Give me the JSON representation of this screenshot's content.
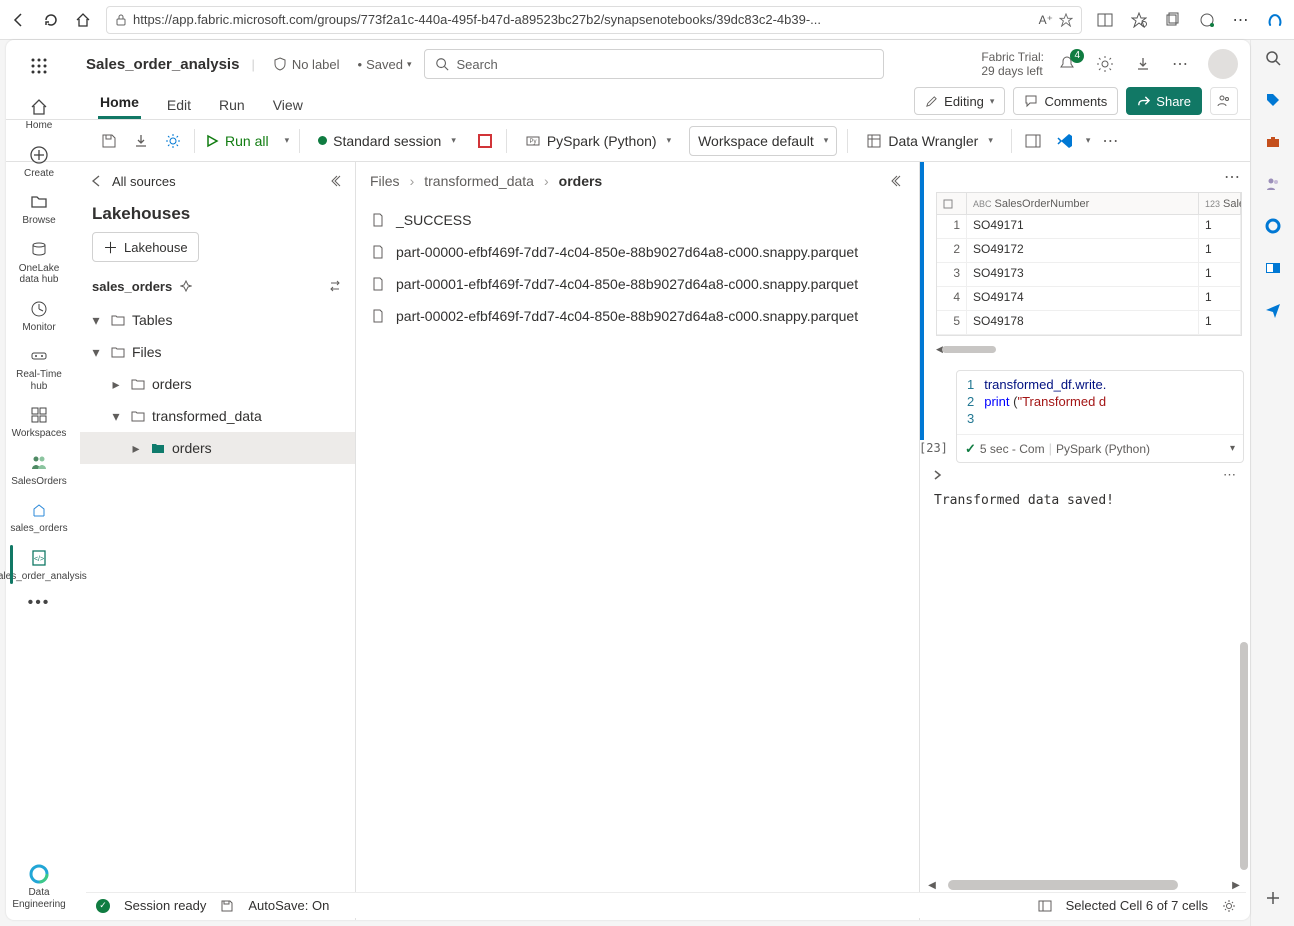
{
  "browser": {
    "url": "https://app.fabric.microsoft.com/groups/773f2a1c-440a-495f-b47d-a89523bc27b2/synapsenotebooks/39dc83c2-4b39-..."
  },
  "leftNav": {
    "items": [
      "Home",
      "Create",
      "Browse",
      "OneLake data hub",
      "Monitor",
      "Real-Time hub",
      "Workspaces",
      "SalesOrders",
      "sales_orders",
      "Sales_order_analysis"
    ],
    "more": "...",
    "bottom": "Data Engineering"
  },
  "header": {
    "title": "Sales_order_analysis",
    "label": "No label",
    "saved": "Saved",
    "searchPlaceholder": "Search",
    "trialLine1": "Fabric Trial:",
    "trialLine2": "29 days left",
    "notifBadge": "4"
  },
  "ribbon": {
    "tabs": [
      "Home",
      "Edit",
      "Run",
      "View"
    ],
    "editing": "Editing",
    "comments": "Comments",
    "share": "Share"
  },
  "toolbar": {
    "runAll": "Run all",
    "session": "Standard session",
    "language": "PySpark (Python)",
    "env": "Workspace default",
    "dataWrangler": "Data Wrangler"
  },
  "explorer": {
    "allSources": "All sources",
    "title": "Lakehouses",
    "addLakehouse": "Lakehouse",
    "lakehouseName": "sales_orders",
    "nodes": {
      "tables": "Tables",
      "files": "Files",
      "orders": "orders",
      "transformed": "transformed_data",
      "ordersSub": "orders"
    }
  },
  "breadcrumb": {
    "c1": "Files",
    "c2": "transformed_data",
    "c3": "orders"
  },
  "files": [
    "_SUCCESS",
    "part-00000-efbf469f-7dd7-4c04-850e-88b9027d64a8-c000.snappy.parquet",
    "part-00001-efbf469f-7dd7-4c04-850e-88b9027d64a8-c000.snappy.parquet",
    "part-00002-efbf469f-7dd7-4c04-850e-88b9027d64a8-c000.snappy.parquet"
  ],
  "nb": {
    "tableHeader1": "SalesOrderNumber",
    "tableHeader2": "Sale",
    "rows": [
      {
        "i": "1",
        "so": "SO49171",
        "v": "1"
      },
      {
        "i": "2",
        "so": "SO49172",
        "v": "1"
      },
      {
        "i": "3",
        "so": "SO49173",
        "v": "1"
      },
      {
        "i": "4",
        "so": "SO49174",
        "v": "1"
      },
      {
        "i": "5",
        "so": "SO49178",
        "v": "1"
      }
    ],
    "codeLines": {
      "l1a": "transformed_df.write.",
      "l2a": "print",
      "l2b": " (",
      "l2c": "\"Transformed d"
    },
    "cellNum": "[23]",
    "footer1": "5 sec - Com",
    "footer2": "PySpark (Python)",
    "output": "Transformed data saved!"
  },
  "status": {
    "ready": "Session ready",
    "autosave": "AutoSave: On",
    "cells": "Selected Cell 6 of 7 cells"
  }
}
